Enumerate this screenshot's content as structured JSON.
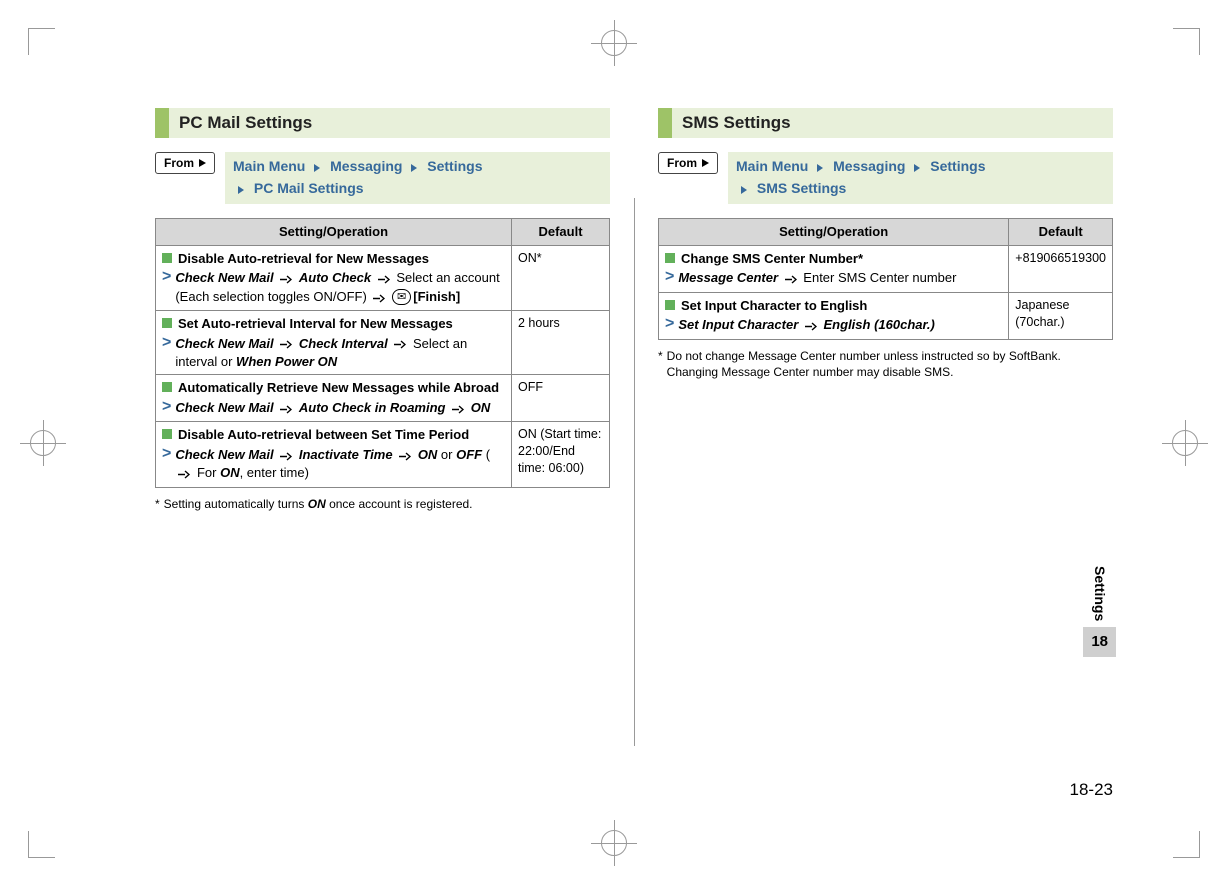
{
  "layout": {
    "from_label": "From",
    "header_setting": "Setting/Operation",
    "header_default": "Default"
  },
  "nav": {
    "main_menu": "Main Menu",
    "messaging": "Messaging",
    "settings": "Settings"
  },
  "pc": {
    "title": "PC Mail Settings",
    "crumb_leaf": "PC Mail Settings",
    "rows": [
      {
        "title": "Disable Auto-retrieval for New Messages",
        "op_html": "<b><i>Check New Mail</i></b> <span class='arr'><svg width='12' height='9'><path d='M0 4.5 H7 M7 1 L11 4.5 L7 8' stroke='#000' fill='none' stroke-width='1.4'/></svg></span> <b><i>Auto Check</i></b> <span class='arr'><svg width='12' height='9'><path d='M0 4.5 H7 M7 1 L11 4.5 L7 8' stroke='#000' fill='none' stroke-width='1.4'/></svg></span> Select an account (Each selection toggles ON/OFF) <span class='arr'><svg width='12' height='9'><path d='M0 4.5 H7 M7 1 L11 4.5 L7 8' stroke='#000' fill='none' stroke-width='1.4'/></svg></span> <span class='mail-key'>✉</span><b>[Finish]</b>",
        "default": "ON*"
      },
      {
        "title": "Set Auto-retrieval Interval for New Messages",
        "op_html": "<b><i>Check New Mail</i></b> <span class='arr'><svg width='12' height='9'><path d='M0 4.5 H7 M7 1 L11 4.5 L7 8' stroke='#000' fill='none' stroke-width='1.4'/></svg></span> <b><i>Check Interval</i></b> <span class='arr'><svg width='12' height='9'><path d='M0 4.5 H7 M7 1 L11 4.5 L7 8' stroke='#000' fill='none' stroke-width='1.4'/></svg></span> Select an interval or <b><i>When Power ON</i></b>",
        "default": "2 hours"
      },
      {
        "title": "Automatically Retrieve New Messages while Abroad",
        "op_html": "<b><i>Check New Mail</i></b> <span class='arr'><svg width='12' height='9'><path d='M0 4.5 H7 M7 1 L11 4.5 L7 8' stroke='#000' fill='none' stroke-width='1.4'/></svg></span> <b><i>Auto Check in Roaming</i></b> <span class='arr'><svg width='12' height='9'><path d='M0 4.5 H7 M7 1 L11 4.5 L7 8' stroke='#000' fill='none' stroke-width='1.4'/></svg></span> <b><i>ON</i></b>",
        "default": "OFF"
      },
      {
        "title": "Disable Auto-retrieval between Set Time Period",
        "op_html": "<b><i>Check New Mail</i></b> <span class='arr'><svg width='12' height='9'><path d='M0 4.5 H7 M7 1 L11 4.5 L7 8' stroke='#000' fill='none' stroke-width='1.4'/></svg></span> <b><i>Inactivate Time</i></b> <span class='arr'><svg width='12' height='9'><path d='M0 4.5 H7 M7 1 L11 4.5 L7 8' stroke='#000' fill='none' stroke-width='1.4'/></svg></span> <b><i>ON</i></b> or <b><i>OFF</i></b> (<span class='arr'><svg width='12' height='9'><path d='M0 4.5 H7 M7 1 L11 4.5 L7 8' stroke='#000' fill='none' stroke-width='1.4'/></svg></span> For <b><i>ON</i></b>, enter time)",
        "default": "ON (Start time: 22:00/End time: 06:00)"
      }
    ],
    "footnote_html": "Setting automatically turns <b><i>ON</i></b> once account is registered."
  },
  "sms": {
    "title": "SMS Settings",
    "crumb_leaf": "SMS Settings",
    "rows": [
      {
        "title": "Change SMS Center Number*",
        "op_html": "<b><i>Message Center</i></b> <span class='arr'><svg width='12' height='9'><path d='M0 4.5 H7 M7 1 L11 4.5 L7 8' stroke='#000' fill='none' stroke-width='1.4'/></svg></span> Enter SMS Center number",
        "default": "+819066519300"
      },
      {
        "title": "Set Input Character to English",
        "op_html": "<b><i>Set Input Character</i></b> <span class='arr'><svg width='12' height='9'><path d='M0 4.5 H7 M7 1 L11 4.5 L7 8' stroke='#000' fill='none' stroke-width='1.4'/></svg></span> <b><i>English (160char.)</i></b>",
        "default": "Japanese (70char.)"
      }
    ],
    "footnote": "Do not change Message Center number unless instructed so by SoftBank. Changing Message Center number may disable SMS."
  },
  "side": {
    "label": "Settings",
    "chapter": "18"
  },
  "page_number": "18-23"
}
